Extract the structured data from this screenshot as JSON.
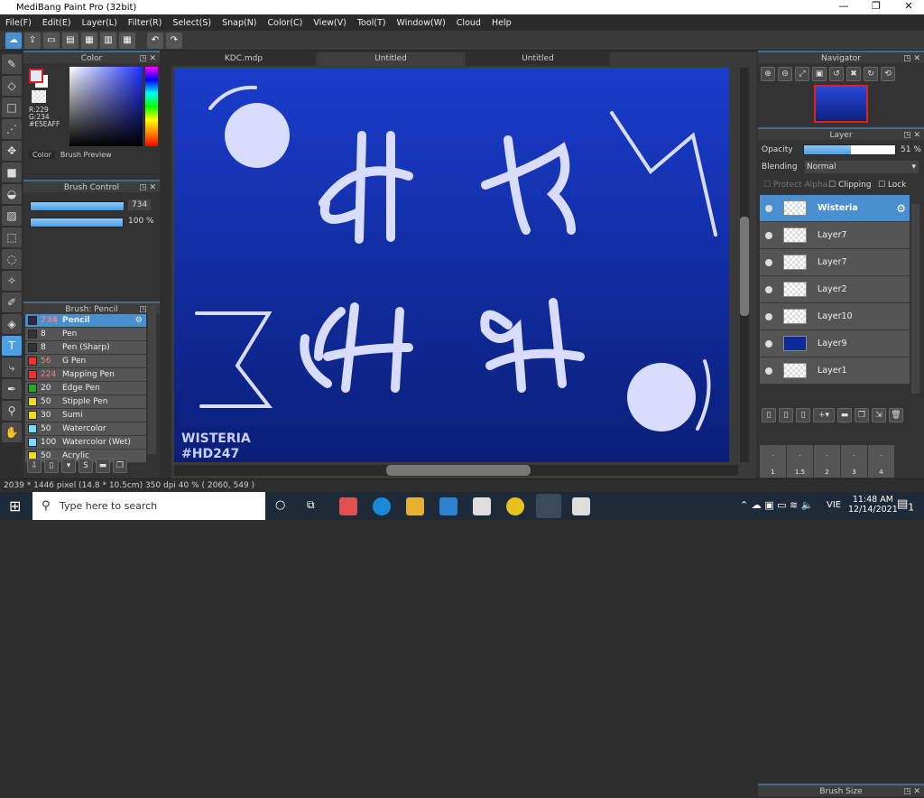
{
  "app": {
    "title": "MediBang Paint Pro (32bit)"
  },
  "menu": [
    "File(F)",
    "Edit(E)",
    "Layer(L)",
    "Filter(R)",
    "Select(S)",
    "Snap(N)",
    "Color(C)",
    "View(V)",
    "Tool(T)",
    "Window(W)",
    "Cloud",
    "Help"
  ],
  "color_panel": {
    "title": "Color",
    "r": "R:229",
    "g": "G:234",
    "hex": "#E5EAFF",
    "tabs": [
      "Color",
      "Brush Preview"
    ],
    "current": "#E5EAFF"
  },
  "brush_control": {
    "title": "Brush Control",
    "size": "734",
    "opacity": "100 %"
  },
  "brush_panel": {
    "title": "Brush: Pencil",
    "items": [
      {
        "size": "734",
        "name": "Pencil",
        "color": "#2a2a3a",
        "selected": true
      },
      {
        "size": "8",
        "name": "Pen",
        "color": "#333333"
      },
      {
        "size": "8",
        "name": "Pen (Sharp)",
        "color": "#333333"
      },
      {
        "size": "56",
        "name": "G Pen",
        "color": "#ee3030"
      },
      {
        "size": "224",
        "name": "Mapping Pen",
        "color": "#ee3030"
      },
      {
        "size": "20",
        "name": "Edge Pen",
        "color": "#22aa22"
      },
      {
        "size": "50",
        "name": "Stipple Pen",
        "color": "#eedd22"
      },
      {
        "size": "30",
        "name": "Sumi",
        "color": "#eedd22"
      },
      {
        "size": "50",
        "name": "Watercolor",
        "color": "#77ddff"
      },
      {
        "size": "100",
        "name": "Watercolor (Wet)",
        "color": "#77ddff"
      },
      {
        "size": "50",
        "name": "Acrylic",
        "color": "#eedd22"
      }
    ]
  },
  "tabs": [
    "KDC.mdp",
    "Untitled",
    "Untitled"
  ],
  "artwork": {
    "signature": "WISTERIA",
    "code": "#HD247"
  },
  "navigator": {
    "title": "Navigator"
  },
  "layer_panel": {
    "title": "Layer",
    "opacity_label": "Opacity",
    "opacity_value": "51 %",
    "opacity": 51,
    "blending_label": "Blending",
    "blending": "Normal",
    "protect_alpha": "Protect Alpha",
    "clipping": "Clipping",
    "lock": "Lock",
    "layers": [
      {
        "name": "Wisteria",
        "selected": true
      },
      {
        "name": "Layer7"
      },
      {
        "name": "Layer7"
      },
      {
        "name": "Layer2"
      },
      {
        "name": "Layer10"
      },
      {
        "name": "Layer9",
        "blue": true
      },
      {
        "name": "Layer1"
      }
    ]
  },
  "brush_size": {
    "title": "Brush Size",
    "sizes": [
      "1",
      "1.5",
      "2",
      "3",
      "4"
    ]
  },
  "status": {
    "text": "2039 * 1446 pixel   (14.8 * 10.5cm)  350 dpi   40 %   ( 2060, 549 )"
  },
  "taskbar": {
    "search_placeholder": "Type here to search",
    "lang": "VIE",
    "time": "11:48 AM",
    "date": "12/14/2021",
    "notif": "1"
  }
}
